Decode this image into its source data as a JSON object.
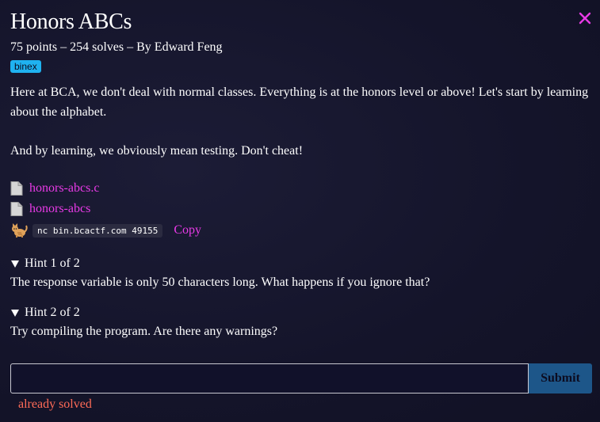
{
  "challenge": {
    "title": "Honors ABCs",
    "meta": "75 points – 254 solves – By Edward Feng",
    "tag": "binex",
    "description": [
      "Here at BCA, we don't deal with normal classes. Everything is at the honors level or above! Let's start by learning about the alphabet.",
      "And by learning, we obviously mean testing. Don't cheat!"
    ],
    "files": [
      {
        "name": "honors-abcs.c",
        "icon": "file-icon"
      },
      {
        "name": "honors-abcs",
        "icon": "file-icon"
      }
    ],
    "connection": {
      "icon": "cat-icon",
      "command": "nc bin.bcactf.com 49155",
      "copy_label": "Copy"
    },
    "hints": [
      {
        "summary": "Hint 1 of 2",
        "text": "The response variable is only 50 characters long. What happens if you ignore that?"
      },
      {
        "summary": "Hint 2 of 2",
        "text": "Try compiling the program. Are there any warnings?"
      }
    ]
  },
  "form": {
    "input_value": "",
    "submit_label": "Submit",
    "status": "already solved"
  },
  "colors": {
    "accent_link": "#e83ae6",
    "tag_bg": "#1fb2f0",
    "submit_bg": "#1d5689",
    "status": "#ff6b57",
    "close": "#e83ae6"
  }
}
